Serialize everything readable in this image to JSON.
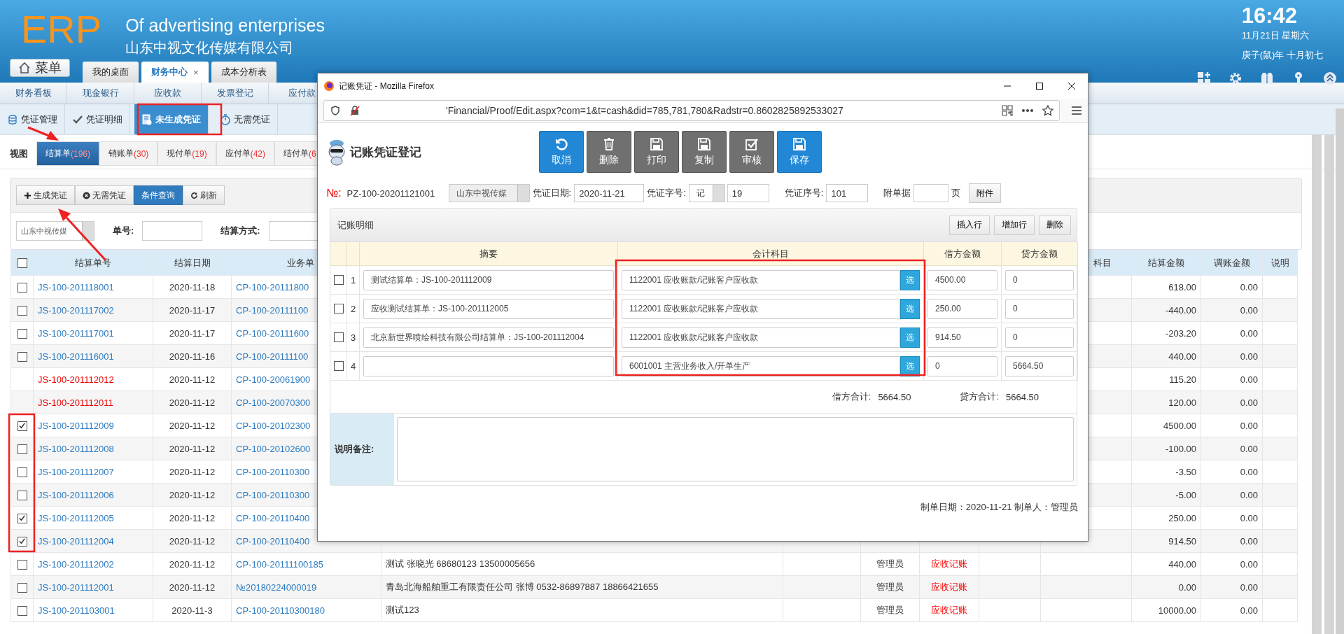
{
  "header": {
    "logo": "ERP",
    "title": "Of advertising enterprises",
    "company": "山东中视文化传媒有限公司",
    "menu_button": "菜单",
    "tabs": [
      {
        "label": "我的桌面",
        "selected": false
      },
      {
        "label": "财务中心",
        "selected": true,
        "close": "×"
      },
      {
        "label": "成本分析表",
        "selected": false
      }
    ],
    "clock": {
      "time": "16:42",
      "date": "11月21日 星期六",
      "lunar": "庚子(鼠)年 十月初七"
    }
  },
  "nav_primary": [
    "财务看板",
    "现金银行",
    "应收款",
    "发票登记",
    "应付款"
  ],
  "nav_secondary": [
    {
      "label": "凭证管理",
      "selected": false,
      "kind": "coins"
    },
    {
      "label": "凭证明细",
      "selected": false,
      "kind": "check"
    },
    {
      "label": "未生成凭证",
      "selected": true,
      "kind": "document"
    },
    {
      "label": "无需凭证",
      "selected": false,
      "kind": "stopwatch"
    }
  ],
  "view": {
    "label": "视图",
    "tabs": [
      {
        "label": "结算单",
        "count": "(196)",
        "selected": true
      },
      {
        "label": "销账单",
        "count": "(30)",
        "selected": false
      },
      {
        "label": "现付单",
        "count": "(19)",
        "selected": false
      },
      {
        "label": "应付单",
        "count": "(42)",
        "selected": false
      },
      {
        "label": "结付单",
        "count": "(6",
        "selected": false
      }
    ]
  },
  "toolbar": [
    {
      "label": "生成凭证",
      "selected": false,
      "kind": "plus"
    },
    {
      "label": "无需凭证",
      "selected": false,
      "kind": "circle-x"
    },
    {
      "label": "条件查询",
      "selected": true,
      "kind": "none"
    },
    {
      "label": "刷新",
      "selected": false,
      "kind": "refresh"
    }
  ],
  "filter": {
    "company": "山东中视传媒",
    "fields": [
      {
        "label": "单号:"
      },
      {
        "label": "结算方式:"
      }
    ]
  },
  "table": {
    "select_all_checked": false,
    "columns": [
      "结算单号",
      "结算日期",
      "业务单",
      "科目",
      "结算金额",
      "调账金额",
      "说明"
    ],
    "rows": [
      {
        "kind": "normal",
        "checked": false,
        "number": "JS-100-201118001",
        "date": "2020-11-18",
        "business": "CP-100-20111800",
        "amount": "618.00",
        "adjust": "0.00"
      },
      {
        "kind": "normal",
        "checked": false,
        "number": "JS-100-201117002",
        "date": "2020-11-17",
        "business": "CP-100-20111100",
        "amount": "-440.00",
        "adjust": "0.00"
      },
      {
        "kind": "normal",
        "checked": false,
        "number": "JS-100-201117001",
        "date": "2020-11-17",
        "business": "CP-100-20111600",
        "amount": "-203.20",
        "adjust": "0.00"
      },
      {
        "kind": "normal",
        "checked": false,
        "number": "JS-100-201116001",
        "date": "2020-11-16",
        "business": "CP-100-20111100",
        "amount": "440.00",
        "adjust": "0.00"
      },
      {
        "kind": "posted",
        "number": "JS-100-201112012",
        "date": "2020-11-12",
        "business": "CP-100-20061900",
        "amount": "115.20",
        "adjust": "0.00"
      },
      {
        "kind": "posted",
        "number": "JS-100-201112011",
        "date": "2020-11-12",
        "business": "CP-100-20070300",
        "amount": "120.00",
        "adjust": "0.00"
      },
      {
        "kind": "normal",
        "checked": true,
        "number": "JS-100-201112009",
        "date": "2020-11-12",
        "business": "CP-100-20102300",
        "amount": "4500.00",
        "adjust": "0.00"
      },
      {
        "kind": "normal",
        "checked": false,
        "number": "JS-100-201112008",
        "date": "2020-11-12",
        "business": "CP-100-20102600",
        "amount": "-100.00",
        "adjust": "0.00"
      },
      {
        "kind": "normal",
        "checked": false,
        "number": "JS-100-201112007",
        "date": "2020-11-12",
        "business": "CP-100-20110300",
        "amount": "-3.50",
        "adjust": "0.00"
      },
      {
        "kind": "normal",
        "checked": false,
        "number": "JS-100-201112006",
        "date": "2020-11-12",
        "business": "CP-100-20110300",
        "amount": "-5.00",
        "adjust": "0.00"
      },
      {
        "kind": "normal",
        "checked": true,
        "number": "JS-100-201112005",
        "date": "2020-11-12",
        "business": "CP-100-20110400",
        "amount": "250.00",
        "adjust": "0.00"
      },
      {
        "kind": "normal",
        "checked": true,
        "number": "JS-100-201112004",
        "date": "2020-11-12",
        "business": "CP-100-20110400",
        "amount": "914.50",
        "adjust": "0.00"
      },
      {
        "kind": "normal",
        "checked": false,
        "number": "JS-100-201112002",
        "date": "2020-11-12",
        "business": "CP-100-20111100185",
        "description": "测试 张晓光 68680123 13500005656",
        "operator": "管理员",
        "status": {
          "text": "应收记账",
          "color": "#ff0000"
        },
        "amount": "440.00",
        "adjust": "0.00"
      },
      {
        "kind": "normal",
        "checked": false,
        "number": "JS-100-201112001",
        "date": "2020-11-12",
        "business": "№20180224000019",
        "description": "青岛北海船舶重工有限责任公司 张博 0532-86897887 18866421655",
        "operator": "管理员",
        "status": {
          "text": "应收记账",
          "color": "#ff0000"
        },
        "amount": "0.00",
        "adjust": "0.00"
      },
      {
        "kind": "normal",
        "checked": false,
        "number": "JS-100-201103001",
        "date": "2020-11-3",
        "business": "CP-100-20110300180",
        "description": "测试123",
        "operator": "管理员",
        "status": {
          "text": "应收记账",
          "color": "#ff0000"
        },
        "amount": "10000.00",
        "adjust": "0.00"
      }
    ]
  },
  "popup": {
    "window_title": "记账凭证 - Mozilla Firefox",
    "url": "'Financial/Proof/Edit.aspx?com=1&t=cash&did=785,781,780&Radstr=0.8602825892533027",
    "heading": "记账凭证登记",
    "buttons": [
      {
        "label": "取消",
        "kind": "cancel"
      },
      {
        "label": "删除",
        "kind": "delete"
      },
      {
        "label": "打印",
        "kind": "print"
      },
      {
        "label": "复制",
        "kind": "copy"
      },
      {
        "label": "审核",
        "kind": "audit"
      },
      {
        "label": "保存",
        "kind": "save"
      }
    ],
    "voucher_no_label": "№:",
    "voucher_no": "PZ-100-20201121001",
    "company": "山东中视传媒",
    "date_label": "凭证日期:",
    "date": "2020-11-21",
    "word_label": "凭证字号:",
    "word": "记",
    "word_number": "19",
    "seq_label": "凭证序号:",
    "seq": "101",
    "attach_label": "附单据",
    "attach_unit": "页",
    "attach_button": "附件",
    "detail": {
      "title": "记账明细",
      "buttons": [
        "插入行",
        "增加行",
        "删除"
      ],
      "columns": [
        "摘要",
        "会计科目",
        "借方金额",
        "贷方金额"
      ],
      "rows": [
        {
          "checked": false,
          "index": "1",
          "summary": "测试结算单：JS-100-201112009",
          "account": "1122001 应收账款/记账客户应收款",
          "pick": "选",
          "debit": "4500.00",
          "credit": "0"
        },
        {
          "checked": false,
          "index": "2",
          "summary": "应收测试结算单：JS-100-201112005",
          "account": "1122001 应收账款/记账客户应收款",
          "pick": "选",
          "debit": "250.00",
          "credit": "0"
        },
        {
          "checked": false,
          "index": "3",
          "summary": "北京新世界喷绘科技有限公司结算单：JS-100-201112004",
          "account": "1122001 应收账款/记账客户应收款",
          "pick": "选",
          "debit": "914.50",
          "credit": "0"
        },
        {
          "checked": false,
          "index": "4",
          "account": "6001001 主营业务收入/开单生产",
          "pick": "选",
          "debit": "0",
          "credit": "5664.50"
        }
      ],
      "debit_total_label": "借方合计:",
      "debit_total": "5664.50",
      "credit_total_label": "贷方合计:",
      "credit_total": "5664.50"
    },
    "notes_label": "说明备注:",
    "footer": "制单日期：2020-11-21  制单人：管理员"
  }
}
